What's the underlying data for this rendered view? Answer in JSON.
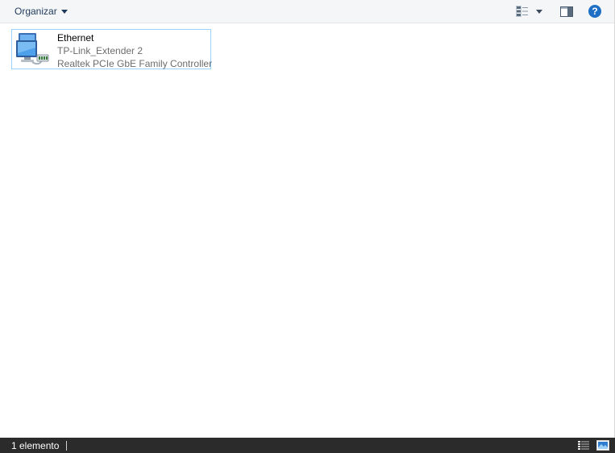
{
  "toolbar": {
    "organize_label": "Organizar",
    "icons": {
      "view": "change-view-icon",
      "view_menu": "chevron-down-icon",
      "preview_pane": "preview-pane-icon",
      "help": "help-icon"
    },
    "help_glyph": "?"
  },
  "items": [
    {
      "name": "Ethernet",
      "network": "TP-Link_Extender 2",
      "adapter": "Realtek PCIe GbE Family Controller",
      "icon": "network-adapter-icon"
    }
  ],
  "statusbar": {
    "count": "1 elemento",
    "icons": {
      "details_view": "details-view-icon",
      "tiles_view": "tiles-view-icon"
    }
  },
  "colors": {
    "toolbar_bg": "#f5f6f7",
    "selection_border": "#99d1ff",
    "statusbar_bg": "#2b2b2b",
    "help_blue": "#1f6fc5"
  }
}
